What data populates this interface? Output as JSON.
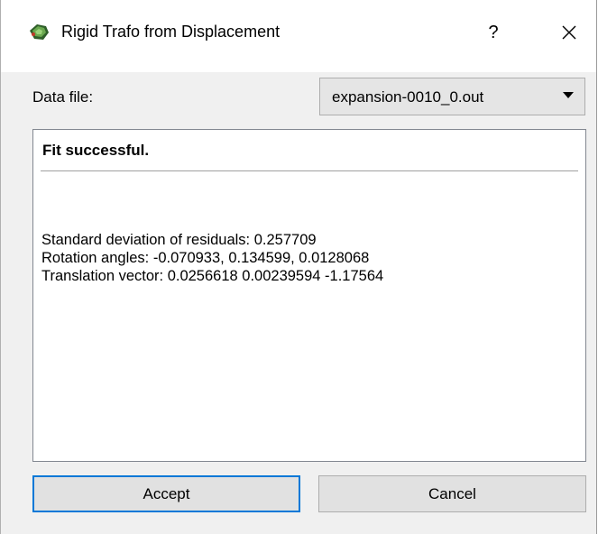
{
  "window": {
    "title": "Rigid Trafo from Displacement",
    "help_label": "?",
    "accent_color": "#0078d7"
  },
  "icons": {
    "app": "app-icon",
    "close": "close-icon",
    "dropdown": "chevron-down-icon"
  },
  "form": {
    "data_file_label": "Data file:",
    "data_file_value": "expansion-0010_0.out"
  },
  "results": {
    "heading": "Fit successful.",
    "lines": [
      "Standard deviation of residuals: 0.257709",
      "Rotation angles: -0.070933, 0.134599, 0.0128068",
      "Translation vector: 0.0256618 0.00239594 -1.17564"
    ]
  },
  "buttons": {
    "accept": "Accept",
    "cancel": "Cancel"
  }
}
